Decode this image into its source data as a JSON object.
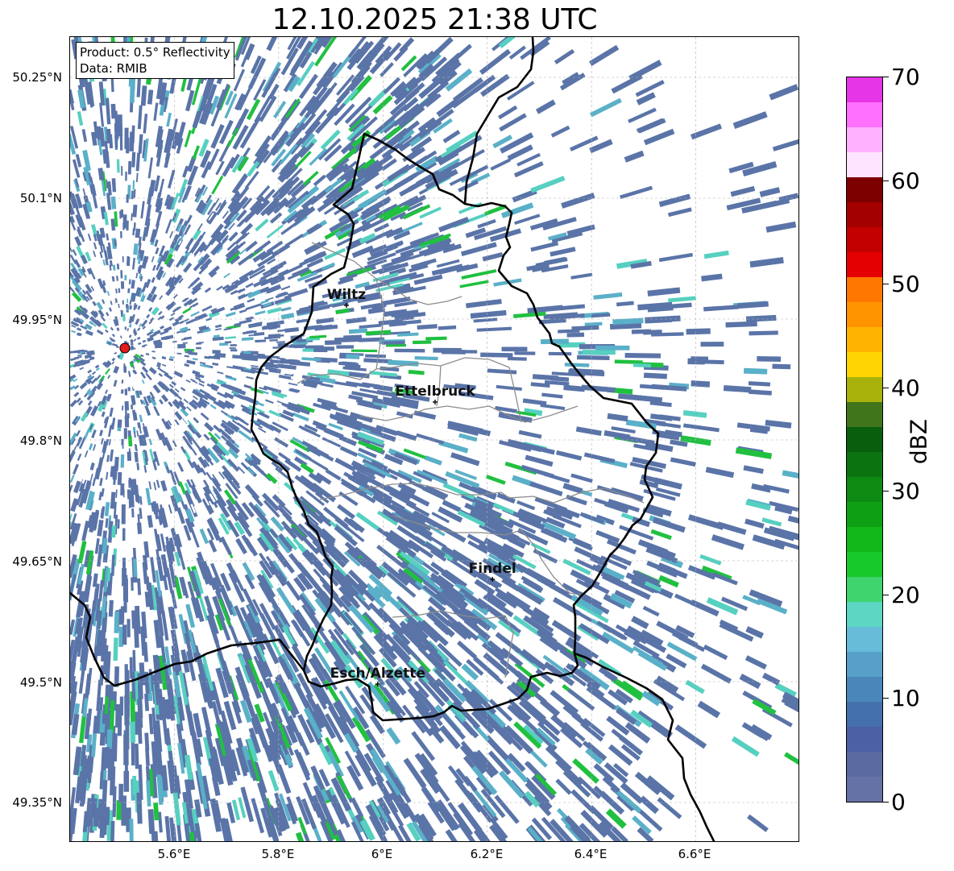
{
  "title": "12.10.2025 21:38 UTC",
  "info": {
    "product": "Product: 0.5° Reflectivity",
    "data_source": "Data: RMIB"
  },
  "axes": {
    "x_ticks": [
      "5.6°E",
      "5.8°E",
      "6°E",
      "6.2°E",
      "6.4°E",
      "6.6°E"
    ],
    "y_ticks": [
      "50.25°N",
      "50.1°N",
      "49.95°N",
      "49.8°N",
      "49.65°N",
      "49.5°N",
      "49.35°N"
    ],
    "lon_range": [
      5.4,
      6.8
    ],
    "lat_range": [
      49.3,
      50.3
    ],
    "grid": true
  },
  "cities": [
    {
      "name": "Wiltz",
      "lon": 5.93,
      "lat": 49.967
    },
    {
      "name": "Ettelbruck",
      "lon": 6.1,
      "lat": 49.847
    },
    {
      "name": "Findel",
      "lon": 6.21,
      "lat": 49.627
    },
    {
      "name": "Esch/Alzette",
      "lon": 5.99,
      "lat": 49.497
    }
  ],
  "radar_site": {
    "lon": 5.505,
    "lat": 49.914,
    "color": "#e41a1c"
  },
  "colorbar": {
    "label": "dBZ",
    "min": 0,
    "max": 70,
    "tick_labels": [
      "0",
      "10",
      "20",
      "30",
      "40",
      "50",
      "60",
      "70"
    ],
    "colors": [
      "#6572a5",
      "#5a6ba1",
      "#4b61a3",
      "#4470ab",
      "#4a86b9",
      "#58a0c9",
      "#66bcd9",
      "#5dd6c4",
      "#3fd46e",
      "#17c92a",
      "#12b71a",
      "#0f9f15",
      "#0d8a12",
      "#0b7410",
      "#095e0d",
      "#41751b",
      "#a8b20a",
      "#ffd400",
      "#ffb500",
      "#ff9400",
      "#ff7700",
      "#e40000",
      "#c30000",
      "#a30000",
      "#7d0000",
      "#ffe4ff",
      "#ffb2ff",
      "#ff70ff",
      "#e635e6"
    ]
  },
  "colors": {
    "echo_main": "#5a74a8",
    "echo_light": "#5ab0c8",
    "echo_cyan": "#56d0c0",
    "echo_green": "#20c040",
    "border_country": "#000000",
    "border_canton": "#8c8c8c"
  }
}
